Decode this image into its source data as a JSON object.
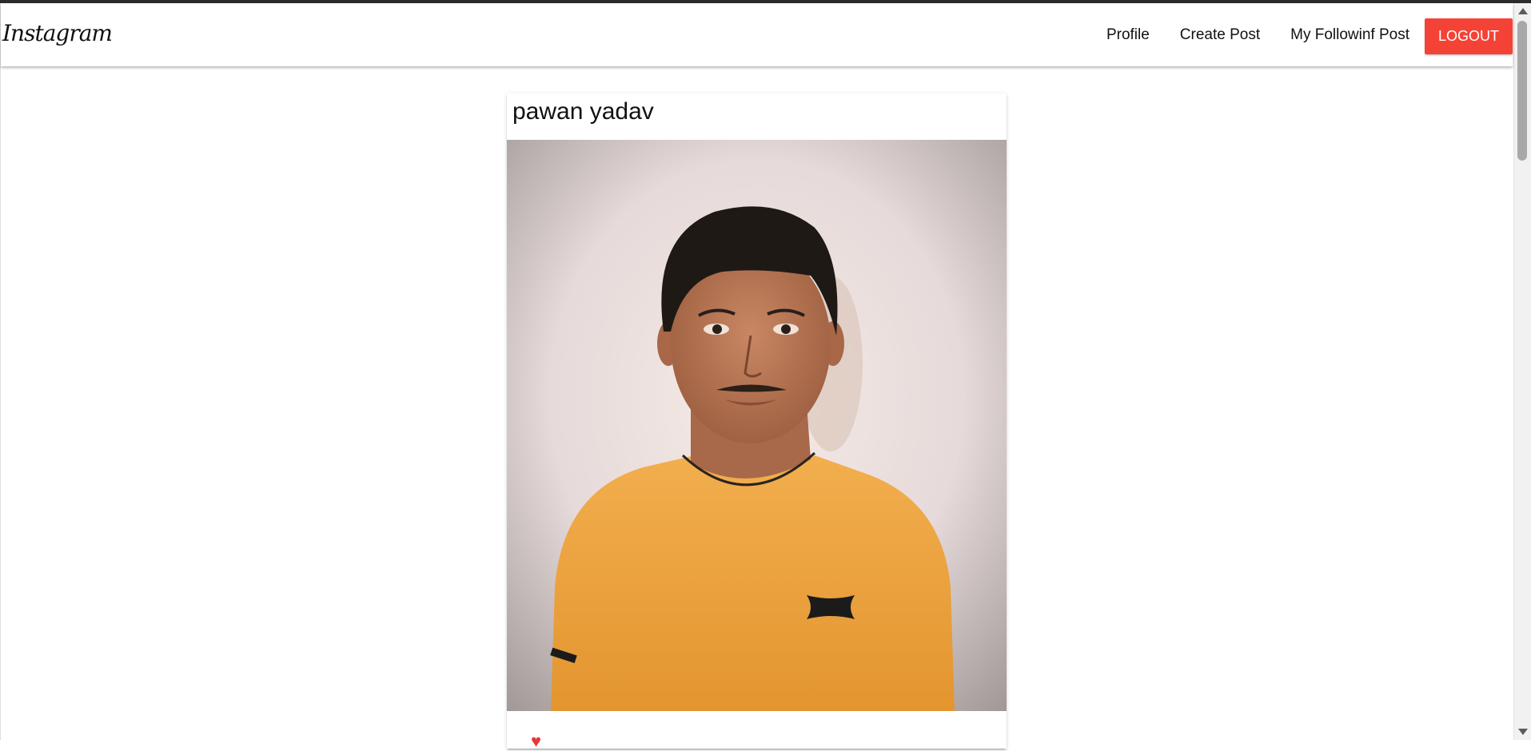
{
  "navbar": {
    "brand": "Instagram",
    "links": [
      "Profile",
      "Create Post",
      "My Followinf Post"
    ],
    "logout_label": "LOGOUT",
    "logout_color": "#f44336"
  },
  "post": {
    "author": "pawan yadav",
    "image_icon": "portrait-photo",
    "like_icon": "heart-icon",
    "like_color": "#e53935"
  }
}
